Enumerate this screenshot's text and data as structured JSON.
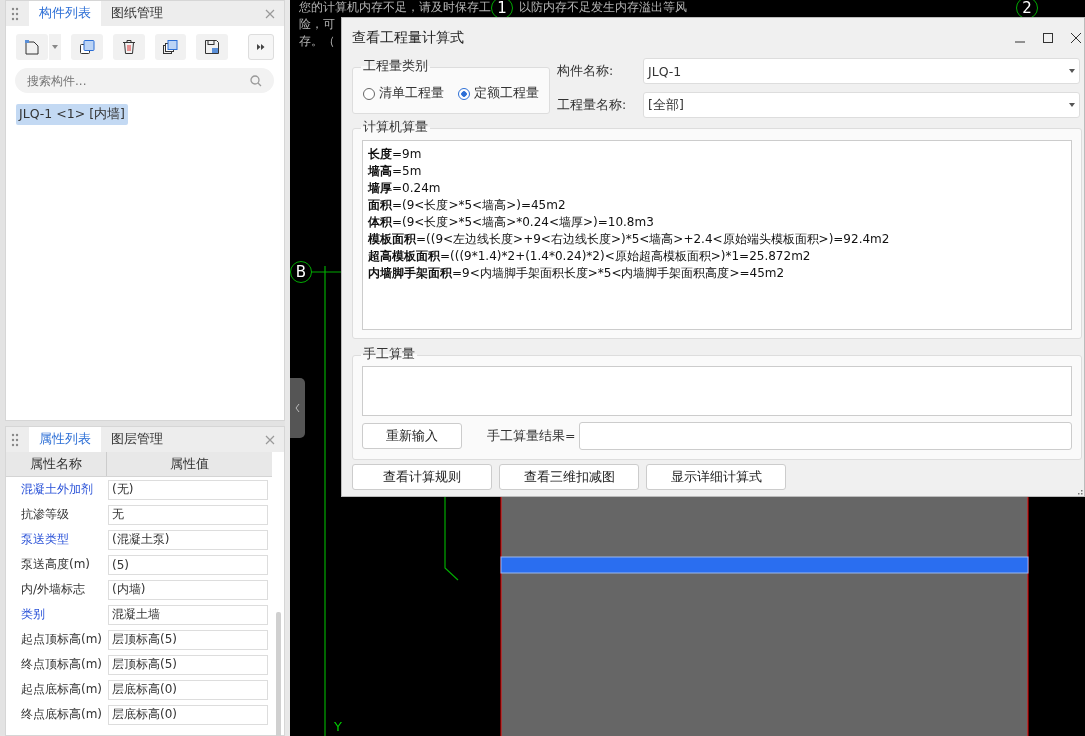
{
  "component_panel": {
    "tabs": [
      {
        "label": "构件列表",
        "selected": true
      },
      {
        "label": "图纸管理",
        "selected": false
      }
    ],
    "search": {
      "placeholder": "搜索构件..."
    },
    "items": [
      {
        "label": "JLQ-1 <1> [内墙]",
        "selected": true
      }
    ]
  },
  "property_panel": {
    "tabs": [
      {
        "label": "属性列表",
        "selected": true
      },
      {
        "label": "图层管理",
        "selected": false
      }
    ],
    "columns": [
      "属性名称",
      "属性值"
    ],
    "rows": [
      {
        "name": "混凝土外加剂",
        "value": "(无)",
        "public": true
      },
      {
        "name": "抗渗等级",
        "value": "无",
        "public": false
      },
      {
        "name": "泵送类型",
        "value": "(混凝土泵)",
        "public": true
      },
      {
        "name": "泵送高度(m)",
        "value": "(5)",
        "public": false
      },
      {
        "name": "内/外墙标志",
        "value": "(内墙)",
        "public": false
      },
      {
        "name": "类别",
        "value": "混凝土墙",
        "public": true
      },
      {
        "name": "起点顶标高(m)",
        "value": "层顶标高(5)",
        "public": false
      },
      {
        "name": "终点顶标高(m)",
        "value": "层顶标高(5)",
        "public": false
      },
      {
        "name": "起点底标高(m)",
        "value": "层底标高(0)",
        "public": false
      },
      {
        "name": "终点底标高(m)",
        "value": "层底标高(0)",
        "public": false
      }
    ]
  },
  "canvas": {
    "notice_lines": [
      [
        "您的计算机内存不足，请及时保存工",
        "以防内存不足发生内存溢出等风"
      ],
      [
        "险，可"
      ],
      [
        "存。（"
      ]
    ],
    "axis_labels": [
      "1",
      "2",
      "B"
    ],
    "axis_name": "Y"
  },
  "dialog": {
    "title": "查看工程量计算式",
    "quantity_type": {
      "label": "工程量类别",
      "options": [
        {
          "label": "清单工程量",
          "selected": false
        },
        {
          "label": "定额工程量",
          "selected": true
        }
      ]
    },
    "fields": [
      {
        "label": "构件名称:",
        "value": "JLQ-1"
      },
      {
        "label": "工程量名称:",
        "value": "[全部]"
      }
    ],
    "computed": {
      "label": "计算机算量",
      "lines": [
        "**长度**=9m",
        "**墙高**=5m",
        "**墙厚**=0.24m",
        "**面积**=(9<长度>*5<墙高>)=45m2",
        "**体积**=(9<长度>*5<墙高>*0.24<墙厚>)=10.8m3",
        "**模板面积**=((9<左边线长度>+9<右边线长度>)*5<墙高>+2.4<原始端头模板面积>)=92.4m2",
        "**超高模板面积**=(((9*1.4)*2+(1.4*0.24)*2)<原始超高模板面积>)*1=25.872m2",
        "**内墙脚手架面积**=9<内墙脚手架面积长度>*5<内墙脚手架面积高度>=45m2"
      ]
    },
    "manual": {
      "label": "手工算量",
      "reset_button": "重新输入",
      "result_label": "手工算量结果="
    },
    "buttons": [
      "查看计算规则",
      "查看三维扣减图",
      "显示详细计算式"
    ]
  }
}
